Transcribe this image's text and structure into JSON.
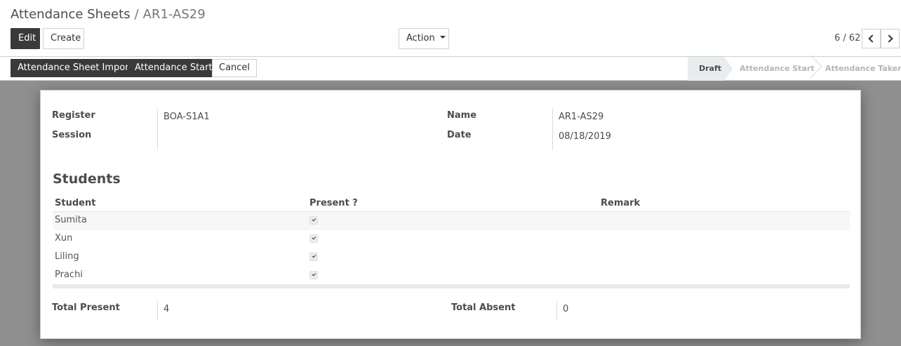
{
  "breadcrumb": {
    "parent": "Attendance Sheets",
    "separator": "/",
    "current": "AR1-AS29"
  },
  "toolbar": {
    "edit_label": "Edit",
    "create_label": "Create",
    "action_label": "Action"
  },
  "pager": {
    "value": "6 / 62"
  },
  "statusbar": {
    "buttons": {
      "import": "Attendance Sheet Import",
      "start": "Attendance Start",
      "cancel": "Cancel"
    },
    "stages": [
      "Draft",
      "Attendance Start",
      "Attendance Taken"
    ],
    "active_stage": "Draft"
  },
  "form": {
    "register_label": "Register",
    "register_value": "BOA-S1A1",
    "session_label": "Session",
    "session_value": "",
    "name_label": "Name",
    "name_value": "AR1-AS29",
    "date_label": "Date",
    "date_value": "08/18/2019"
  },
  "students": {
    "title": "Students",
    "columns": {
      "student": "Student",
      "present": "Present ?",
      "remark": "Remark"
    },
    "rows": [
      {
        "student": "Sumita",
        "present": true,
        "remark": ""
      },
      {
        "student": "Xun",
        "present": true,
        "remark": ""
      },
      {
        "student": "Liling",
        "present": true,
        "remark": ""
      },
      {
        "student": "Prachi",
        "present": true,
        "remark": ""
      }
    ]
  },
  "totals": {
    "present_label": "Total Present",
    "present_value": "4",
    "absent_label": "Total Absent",
    "absent_value": "0"
  }
}
